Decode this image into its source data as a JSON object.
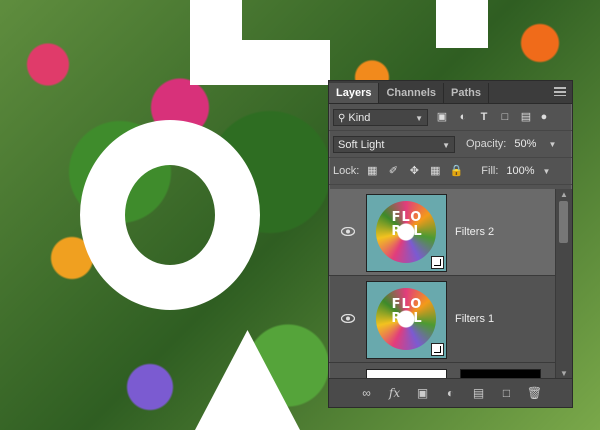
{
  "panel": {
    "tabs": [
      {
        "label": "Layers",
        "active": true
      },
      {
        "label": "Channels",
        "active": false
      },
      {
        "label": "Paths",
        "active": false
      }
    ],
    "filter": {
      "kind_label": "Kind"
    },
    "blend": {
      "mode": "Soft Light",
      "opacity_label": "Opacity:",
      "opacity_value": "50%"
    },
    "lock": {
      "lock_label": "Lock:",
      "fill_label": "Fill:",
      "fill_value": "100%"
    },
    "layers": [
      {
        "name": "Filters 2",
        "selected": true,
        "thumb_text": "FLO\nRAL"
      },
      {
        "name": "Filters 1",
        "selected": false,
        "thumb_text": "FLO\nRAL"
      }
    ],
    "footer_icons": [
      "link-icon",
      "fx-icon",
      "mask-icon",
      "adjustment-icon",
      "folder-icon",
      "new-layer-icon",
      "trash-icon"
    ]
  },
  "colors": {
    "panel_bg": "#535353",
    "selected_row": "#6a6a6a",
    "thumb_bg": "#69a9ad"
  }
}
